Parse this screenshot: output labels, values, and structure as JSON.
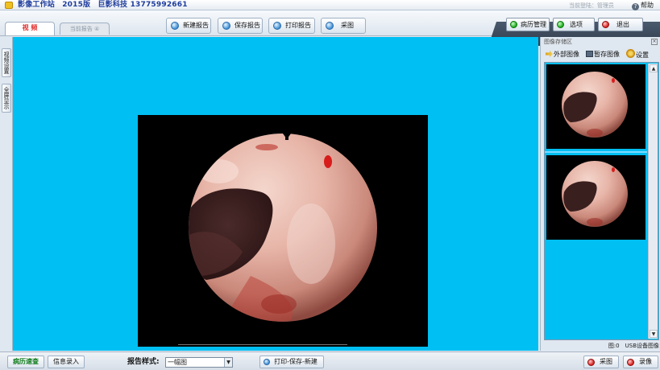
{
  "titlebar": {
    "app_title": "影像工作站　2015版　巨影科技  13775992661",
    "login": "当前登陆：管理员",
    "help": "帮助"
  },
  "tabs": {
    "video": "视 频",
    "report": "当前报告 ④"
  },
  "toolbar": {
    "new_report": "新建报告",
    "save_report": "保存报告",
    "print_report": "打印报告",
    "capture": "采图",
    "history": "病历管理",
    "options": "选项",
    "exit": "退出"
  },
  "left_tabs": {
    "video_settings": "视频设置",
    "fullscreen": "全屏显示"
  },
  "store": {
    "title": "图像存储区",
    "external": "外部图像",
    "temp_save": "暂存图像",
    "settings": "设置",
    "status": "图:0　USB设备图像"
  },
  "bottom": {
    "quick_query": "病历速查",
    "info_entry": "信息录入",
    "style_label": "报告样式:",
    "style_value": "一幅图",
    "print_save_new": "打印-保存-新建",
    "capture": "采图",
    "record": "录像"
  },
  "colors": {
    "video_bg": "#00bff2",
    "title_text": "#1e3c9c",
    "accent_red": "#d81c1c",
    "accent_green": "#18a818"
  }
}
